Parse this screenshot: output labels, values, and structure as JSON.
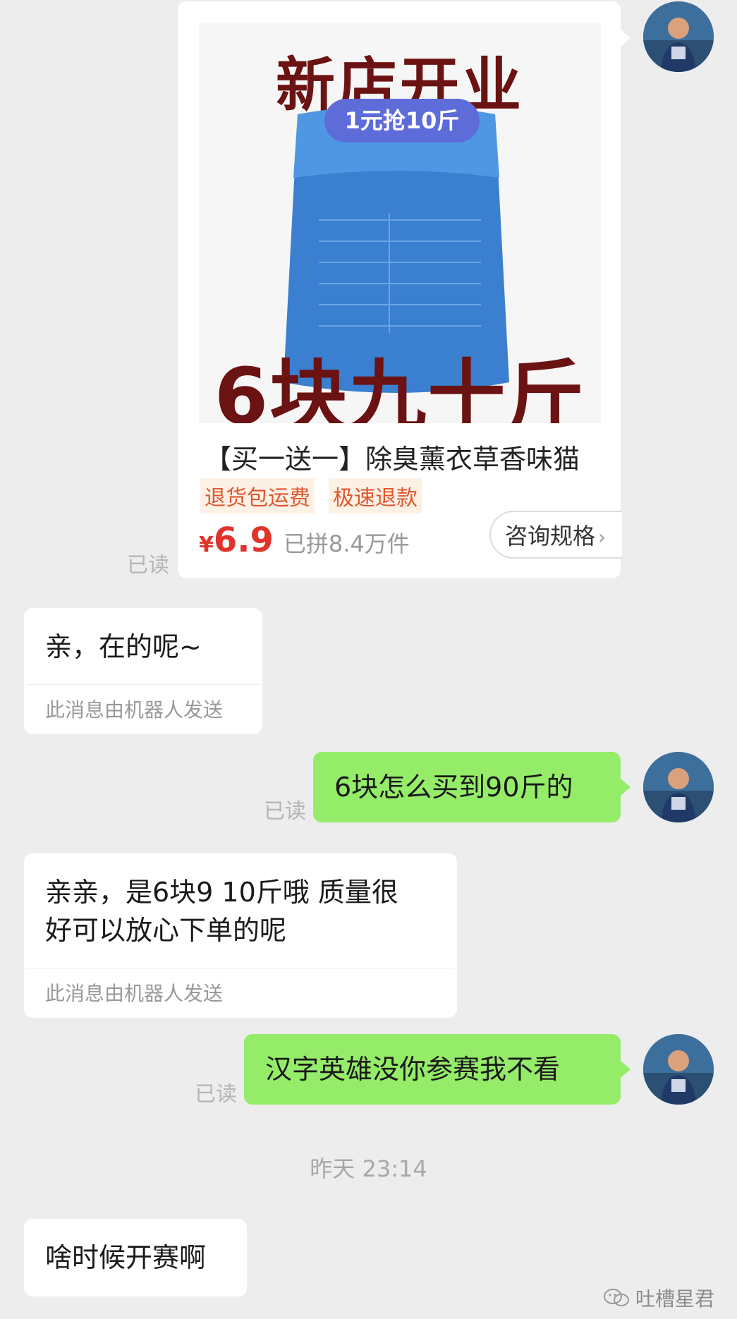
{
  "product_card": {
    "banner_top": "新店开业",
    "promo_label": "1元抢10斤",
    "banner_bottom": "6块九十斤",
    "title": "【买一送一】除臭薰衣草香味猫",
    "tags": [
      "退货包运费",
      "极速退款"
    ],
    "price_symbol": "¥",
    "price": "6.9",
    "sold": "已拼8.4万件",
    "consult_label": "咨询规格"
  },
  "messages": [
    {
      "side": "right",
      "type": "product",
      "read": "已读"
    },
    {
      "side": "left",
      "text": "亲，在的呢~",
      "note": "此消息由机器人发送"
    },
    {
      "side": "right",
      "text": "6块怎么买到90斤的",
      "read": "已读"
    },
    {
      "side": "left",
      "text_line1": "亲亲，是6块9 10斤哦 质量很",
      "text_line2": "好可以放心下单的呢",
      "note": "此消息由机器人发送"
    },
    {
      "side": "right",
      "text": "汉字英雄没你参赛我不看",
      "read": "已读"
    },
    {
      "side": "left",
      "text": "啥时候开赛啊"
    }
  ],
  "timestamp": "昨天 23:14",
  "watermark": "吐槽星君",
  "icons": {
    "avatar": "user-avatar",
    "chevron": "chevron-right-icon",
    "watermark": "wechat-icon"
  },
  "colors": {
    "background": "#ededed",
    "self_bubble": "#95ec69",
    "other_bubble": "#ffffff",
    "price": "#e0332b"
  }
}
